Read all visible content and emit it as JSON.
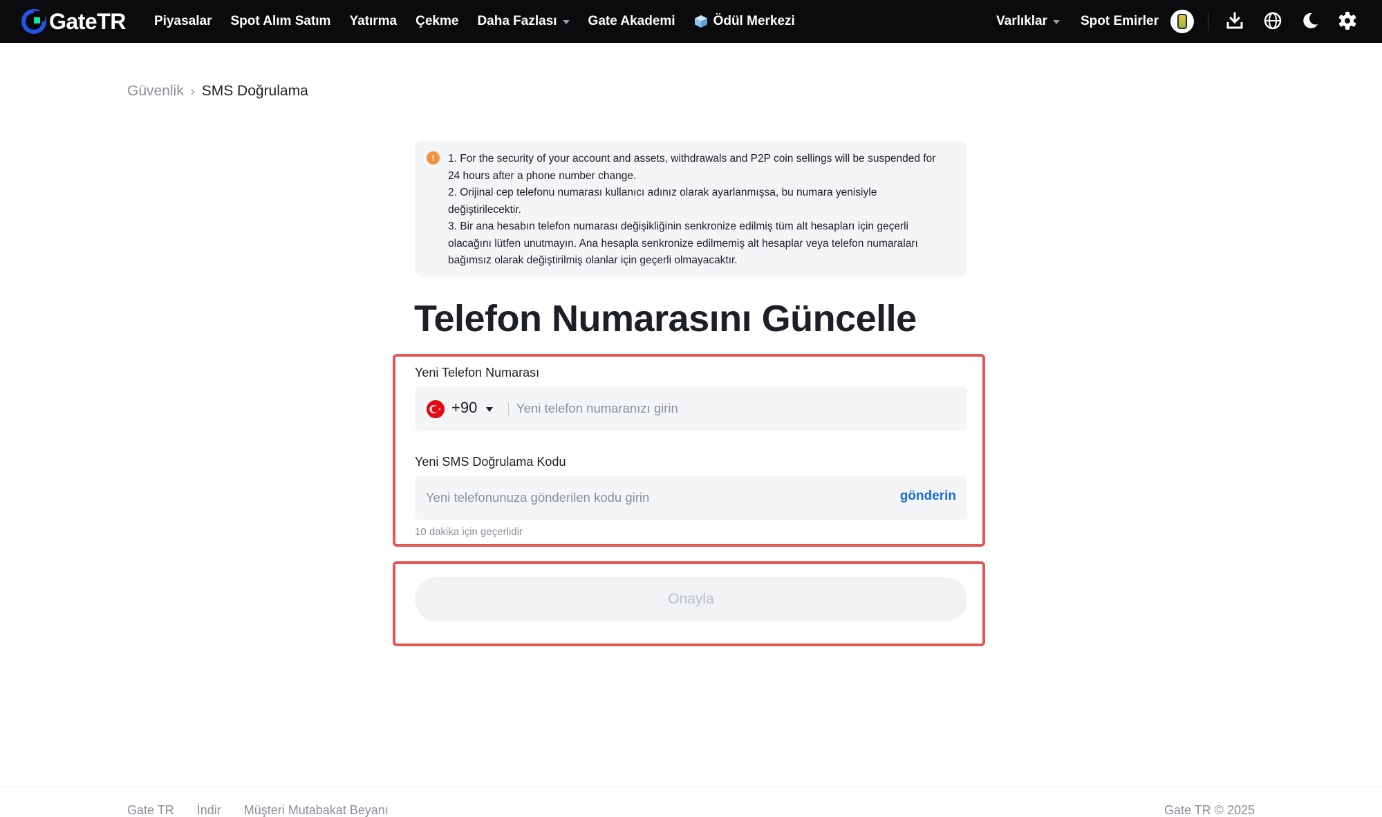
{
  "header": {
    "logo_text": "GateTR",
    "nav": [
      {
        "label": "Piyasalar"
      },
      {
        "label": "Spot Alım Satım"
      },
      {
        "label": "Yatırma"
      },
      {
        "label": "Çekme"
      },
      {
        "label": "Daha Fazlası",
        "has_caret": true
      },
      {
        "label": "Gate Akademi"
      },
      {
        "label": "Ödül Merkezi",
        "icon": "gift-box-icon"
      }
    ],
    "right": {
      "assets_label": "Varlıklar",
      "spot_orders_label": "Spot Emirler",
      "icons": [
        "avatar",
        "download-icon",
        "globe-icon",
        "moon-icon",
        "settings-icon"
      ]
    }
  },
  "breadcrumb": {
    "parent": "Güvenlik",
    "current": "SMS Doğrulama"
  },
  "notice": {
    "icon": "warning-icon",
    "lines": [
      "1. For the security of your account and assets, withdrawals and P2P coin sellings will be suspended for 24 hours after a phone number change.",
      "2. Orijinal cep telefonu numarası kullanıcı adınız olarak ayarlanmışsa, bu numara yenisiyle değiştirilecektir.",
      "3. Bir ana hesabın telefon numarası değişikliğinin senkronize edilmiş tüm alt hesapları için geçerli olacağını lütfen unutmayın. Ana hesapla senkronize edilmemiş alt hesaplar veya telefon numaraları bağımsız olarak değiştirilmiş olanlar için geçerli olmayacaktır."
    ]
  },
  "title": "Telefon Numarasını Güncelle",
  "form": {
    "phone_label": "Yeni Telefon Numarası",
    "country_code": "+90",
    "phone_value": "",
    "phone_placeholder": "Yeni telefon numaranızı girin",
    "sms_label": "Yeni SMS Doğrulama Kodu",
    "sms_value": "",
    "sms_placeholder": "Yeni telefonunuza gönderilen kodu girin",
    "send_label": "gönderin",
    "validity_hint": "10 dakika için geçerlidir",
    "confirm_label": "Onayla"
  },
  "footer": {
    "links": [
      "Gate TR",
      "İndir",
      "Müşteri Mutabakat Beyanı"
    ],
    "copyright": "Gate TR © 2025"
  },
  "colors": {
    "nav_bg": "#0b0b0d",
    "accent_blue": "#1a6ad9",
    "highlight_red": "#e25656",
    "warning_orange": "#f5913d",
    "field_bg": "#f4f5f6"
  }
}
